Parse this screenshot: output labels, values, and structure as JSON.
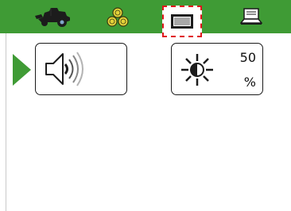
{
  "tabs": [
    {
      "icon": "harvester-icon",
      "selected": false
    },
    {
      "icon": "bales-icon",
      "selected": false
    },
    {
      "icon": "display-icon",
      "selected": true
    },
    {
      "icon": "laptop-icon",
      "selected": false
    }
  ],
  "colors": {
    "bar": "#3f9b35",
    "selection": "#e0151b"
  },
  "volume": {
    "icon": "speaker-icon"
  },
  "brightness": {
    "icon": "brightness-icon",
    "value": "50",
    "unit": "%"
  }
}
